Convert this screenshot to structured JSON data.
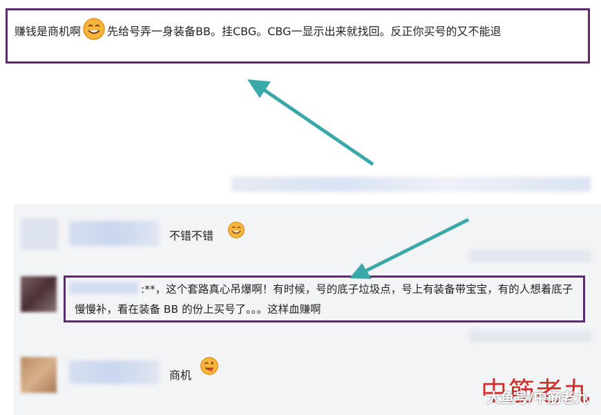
{
  "top_post": {
    "text_before_emoji": "赚钱是商机啊",
    "text_after_emoji": "先给号弄一身装备BB。挂CBG。CBG一显示出来就找回。反正你买号的又不能退",
    "emoji": "smile-emoji"
  },
  "comments": [
    {
      "text": "不错不错",
      "emoji": "smile-emoji"
    },
    {
      "prefix": ":**，",
      "text": "这个套路真心吊爆啊！有时候，号的底子垃圾点，号上有装备带宝宝，有的人想着底子慢慢补，看在装备 BB 的份上买号了。。。这样血赚啊"
    },
    {
      "text": "商机",
      "emoji": "wink-tongue-emoji"
    }
  ],
  "watermark": {
    "main": "中筋老九",
    "sub": "大鱼号/中筋老九"
  },
  "colors": {
    "box_border": "#5b2a6e",
    "arrow": "#3aa8a8",
    "watermark_main": "#d42b2b"
  }
}
